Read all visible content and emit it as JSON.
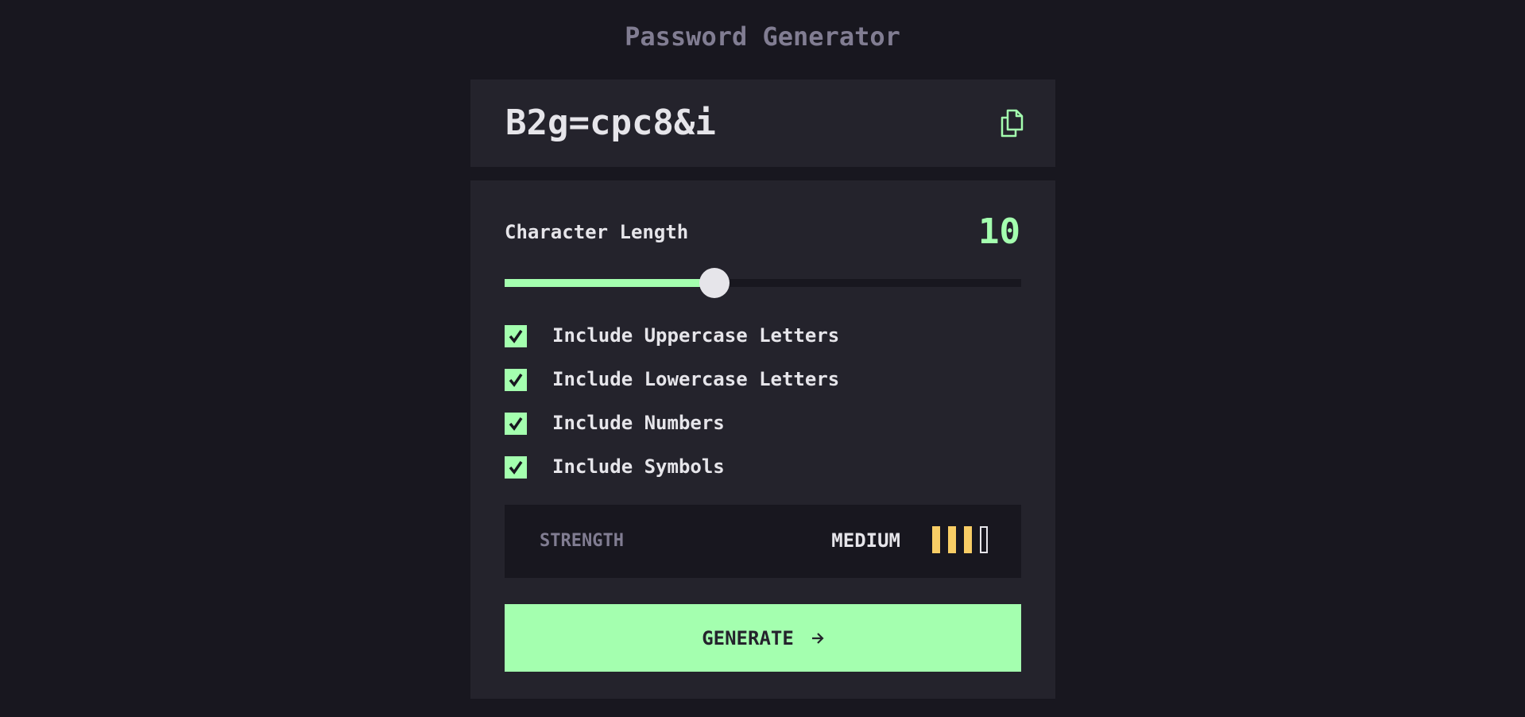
{
  "app": {
    "title": "Password Generator"
  },
  "password": {
    "value": "B2g=cpc8&i",
    "copy_icon": "copy-icon"
  },
  "length": {
    "label": "Character Length",
    "value": "10",
    "slider_fraction": 0.406
  },
  "options": [
    {
      "label": "Include Uppercase Letters",
      "checked": true
    },
    {
      "label": "Include Lowercase Letters",
      "checked": true
    },
    {
      "label": "Include Numbers",
      "checked": true
    },
    {
      "label": "Include Symbols",
      "checked": true
    }
  ],
  "strength": {
    "label": "STRENGTH",
    "value": "MEDIUM",
    "level": 3,
    "max_level": 4
  },
  "generate": {
    "label": "GENERATE",
    "icon": "arrow-right-icon"
  },
  "colors": {
    "background": "#18171f",
    "panel": "#24232c",
    "accent": "#a4ffaf",
    "muted": "#817d92",
    "text": "#e6e5ea",
    "strength_medium": "#f8cd65"
  }
}
